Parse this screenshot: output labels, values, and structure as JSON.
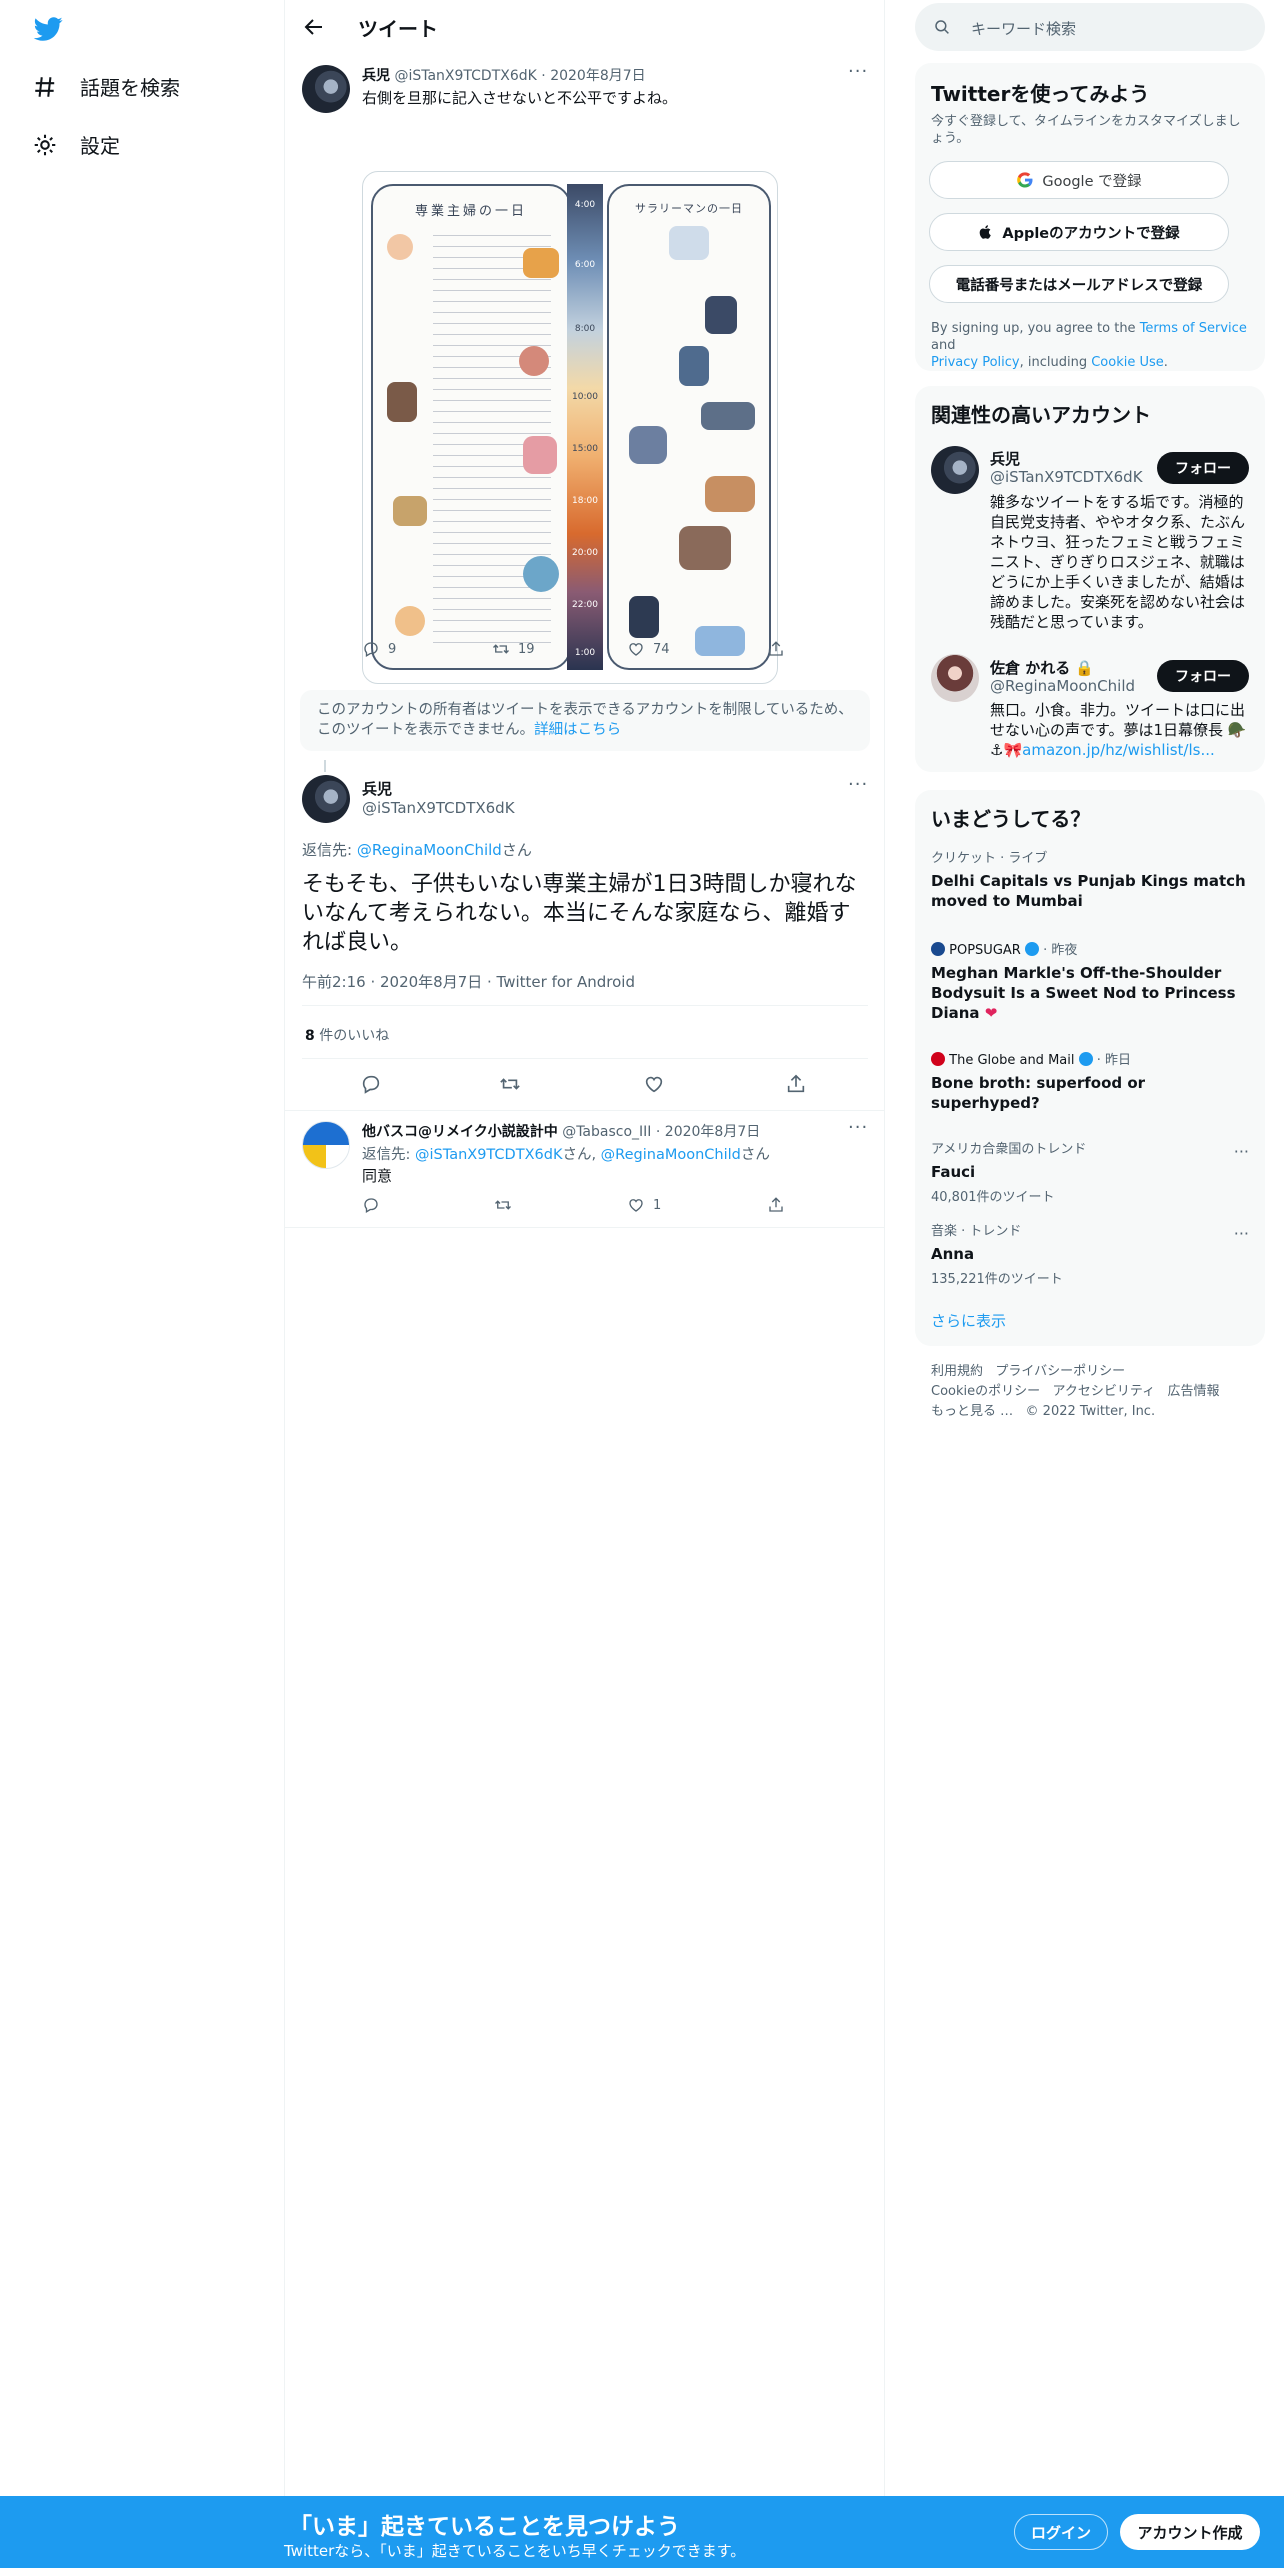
{
  "nav": {
    "explore_label": "話題を検索",
    "settings_label": "設定"
  },
  "header": {
    "title": "ツイート"
  },
  "quoted_tweet": {
    "name": "兵児",
    "handle": "@iSTanX9TCDTX6dK",
    "date": "2020年8月7日",
    "text": "右側を旦那に記入させないと不公平ですよね。",
    "image": {
      "left_title": "専業主婦の一日",
      "right_title": "サラリーマンの一日",
      "times": [
        "4:00",
        "6:00",
        "8:00",
        "10:00",
        "15:00",
        "18:00",
        "20:00",
        "22:00",
        "1:00"
      ]
    },
    "replies": "9",
    "retweets": "19",
    "likes": "74"
  },
  "notice": {
    "text": "このアカウントの所有者はツイートを表示できるアカウントを制限しているため、このツイートを表示できません。",
    "link": "詳細はこちら"
  },
  "main_tweet": {
    "name": "兵児",
    "handle": "@iSTanX9TCDTX6dK",
    "reply_prefix": "返信先: ",
    "reply_to": "@ReginaMoonChild",
    "reply_suffix": "さん",
    "text": "そもそも、子供もいない専業主婦が1日3時間しか寝れないなんて考えられない。本当にそんな家庭なら、離婚すれば良い。",
    "timestamp": "午前2:16 · 2020年8月7日 · Twitter for Android",
    "likes_count": "8",
    "likes_label": " 件のいいね"
  },
  "reply_tweet": {
    "name": "他バスコ@リメイク小説設計中",
    "handle": "@Tabasco_III",
    "date": "2020年8月7日",
    "reply_prefix": "返信先: ",
    "reply_to_1": "@iSTanX9TCDTX6dK",
    "reply_mid": "さん, ",
    "reply_to_2": "@ReginaMoonChild",
    "reply_suffix": "さん",
    "text": "同意",
    "likes": "1"
  },
  "search": {
    "placeholder": "キーワード検索"
  },
  "signup_card": {
    "title": "Twitterを使ってみよう",
    "subtitle": "今すぐ登録して、タイムラインをカスタマイズしましょう。",
    "google_label": "Google で登録",
    "apple_label": "Appleのアカウントで登録",
    "phone_label": "電話番号またはメールアドレスで登録",
    "terms_prefix": "By signing up, you agree to the ",
    "terms_link": "Terms of Service",
    "terms_and": " and",
    "privacy_link": "Privacy Policy",
    "terms_including": ", including ",
    "cookie_link": "Cookie Use",
    "terms_end": "."
  },
  "related": {
    "title": "関連性の高いアカウント",
    "follow_label": "フォロー",
    "accounts": [
      {
        "name": "兵児",
        "handle": "@iSTanX9TCDTX6dK",
        "bio": "雑多なツイートをする垢です。消極的自民党支持者、ややオタク系、たぶんネトウヨ、狂ったフェミと戦うフェミニスト、ぎりぎりロスジェネ、就職はどうにか上手くいきましたが、結婚は諦めました。安楽死を認めない社会は残酷だと思っています。"
      },
      {
        "name": "佐倉 かれる",
        "handle": "@ReginaMoonChild",
        "bio": "無口。小食。非力。ツイートは口に出せない心の声です。夢は1日幕僚長",
        "bio_link": "amazon.jp/hz/wishlist/ls..."
      }
    ]
  },
  "trends": {
    "title": "いまどうしてる？",
    "items": [
      {
        "context": "クリケット · ライブ",
        "title": "Delhi Capitals vs Punjab Kings match moved to Mumbai"
      },
      {
        "source": "POPSUGAR",
        "time": "昨夜",
        "title": "Meghan Markle's Off-the-Shoulder Bodysuit Is a Sweet Nod to Princess Diana"
      },
      {
        "source": "The Globe and Mail",
        "time": "昨日",
        "title": "Bone broth: superfood or superhyped?"
      },
      {
        "context": "アメリカ合衆国のトレンド",
        "title": "Fauci",
        "count": "40,801件のツイート"
      },
      {
        "context": "音楽 · トレンド",
        "title": "Anna",
        "count": "135,221件のツイート"
      }
    ],
    "show_more": "さらに表示"
  },
  "footer": {
    "terms": "利用規約",
    "privacy": "プライバシーポリシー",
    "cookies": "Cookieのポリシー",
    "accessibility": "アクセシビリティ",
    "ads": "広告情報",
    "more": "もっと見る …",
    "copyright": "© 2022 Twitter, Inc."
  },
  "banner": {
    "title": "「いま」起きていることを見つけよう",
    "subtitle": "Twitterなら、「いま」起きていることをいち早くチェックできます。",
    "login_label": "ログイン",
    "signup_label": "アカウント作成"
  },
  "colors": {
    "accent": "#1d9bf0",
    "text": "#0f1419",
    "secondary": "#536471",
    "like_red": "#f91880"
  }
}
